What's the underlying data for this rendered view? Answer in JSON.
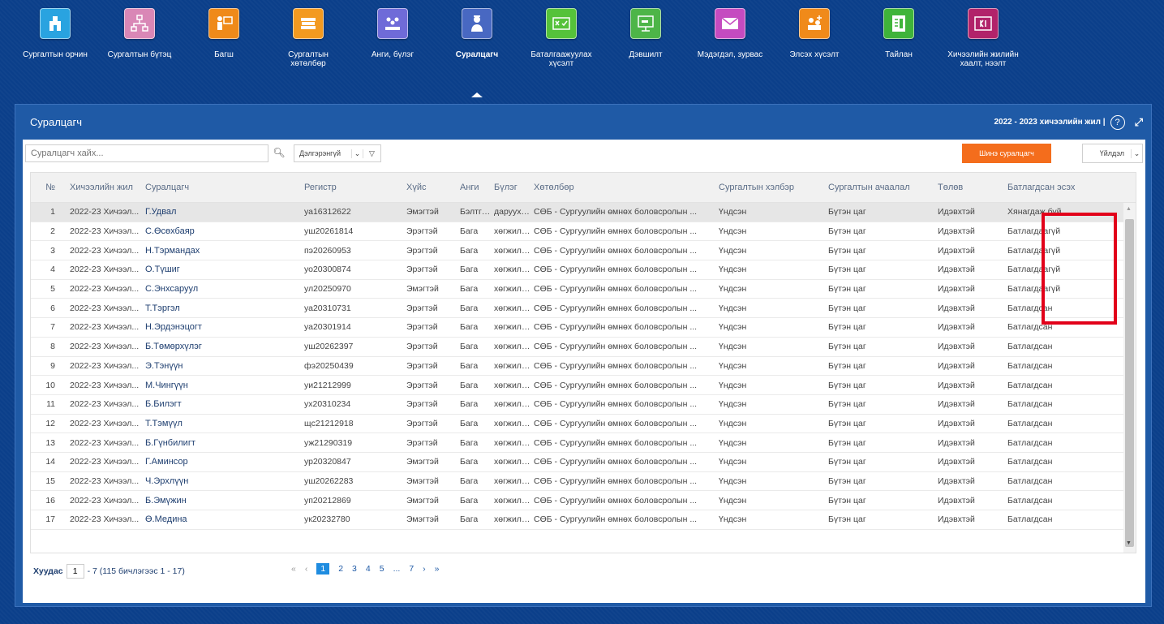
{
  "nav": [
    {
      "label": "Сургалтын орчин",
      "icon": "school-building-icon",
      "color": "#29a3e0",
      "active": false
    },
    {
      "label": "Сургалтын бүтэц",
      "icon": "structure-icon",
      "color": "#d987b6",
      "active": false
    },
    {
      "label": "Багш",
      "icon": "teacher-icon",
      "color": "#ef8a1a",
      "active": false
    },
    {
      "label": "Сургалтын хөтөлбөр",
      "icon": "books-icon",
      "color": "#f39a20",
      "active": false
    },
    {
      "label": "Анги, бүлэг",
      "icon": "classroom-icon",
      "color": "#6f6bd8",
      "active": false
    },
    {
      "label": "Суралцагч",
      "icon": "student-icon",
      "color": "#4868c2",
      "active": true
    },
    {
      "label": "Баталгаажуулах хүсэлт",
      "icon": "approval-request-icon",
      "color": "#55c23a",
      "active": false
    },
    {
      "label": "Дэвшилт",
      "icon": "promotion-icon",
      "color": "#4db548",
      "active": false
    },
    {
      "label": "Мэдэгдэл, зурвас",
      "icon": "message-icon",
      "color": "#c54bc0",
      "active": false
    },
    {
      "label": "Элсэх хүсэлт",
      "icon": "enrollment-request-icon",
      "color": "#f08a1a",
      "active": false
    },
    {
      "label": "Тайлан",
      "icon": "report-icon",
      "color": "#3fb43a",
      "active": false
    },
    {
      "label": "Хичээлийн жилийн хаалт, нээлт",
      "icon": "year-closing-icon",
      "color": "#b1236a",
      "active": false
    }
  ],
  "panel": {
    "title": "Суралцагч",
    "year": "2022 - 2023 хичээлийн жил |",
    "help": "?"
  },
  "toolbar": {
    "search_placeholder": "Суралцагч хайх...",
    "detail_label": "Дэлгэрэнгүй",
    "new_label": "Шинэ суралцагч",
    "action_label": "Үйлдэл"
  },
  "columns": {
    "num": "№",
    "year": "Хичээлийн жил",
    "student": "Суралцагч",
    "register": "Регистр",
    "sex": "Хүйс",
    "class": "Анги",
    "group": "Бүлэг",
    "program": "Хөтөлбөр",
    "form": "Сургалтын хэлбэр",
    "load": "Сургалтын ачаалал",
    "status": "Төлөв",
    "confirmed": "Батлагдсан эсэх"
  },
  "rows": [
    {
      "num": "1",
      "year": "2022-23 Хичээл...",
      "student": "Г.Удвал",
      "register": "уа16312622",
      "sex": "Эмэгтэй",
      "class": "Бэлтгэл",
      "group": "дарууха...",
      "program": "СӨБ - Сургуулийн өмнөх боловсролын ...",
      "form": "Үндсэн",
      "load": "Бүтэн цаг",
      "status": "Идэвхтэй",
      "confirmed": "Хянагдаж буй"
    },
    {
      "num": "2",
      "year": "2022-23 Хичээл...",
      "student": "С.Өсөхбаяр",
      "register": "уш20261814",
      "sex": "Эрэгтэй",
      "class": "Бага",
      "group": "хөгжилт...",
      "program": "СӨБ - Сургуулийн өмнөх боловсролын ...",
      "form": "Үндсэн",
      "load": "Бүтэн цаг",
      "status": "Идэвхтэй",
      "confirmed": "Батлагдаагүй"
    },
    {
      "num": "3",
      "year": "2022-23 Хичээл...",
      "student": "Н.Тэрмандах",
      "register": "пэ20260953",
      "sex": "Эрэгтэй",
      "class": "Бага",
      "group": "хөгжилт...",
      "program": "СӨБ - Сургуулийн өмнөх боловсролын ...",
      "form": "Үндсэн",
      "load": "Бүтэн цаг",
      "status": "Идэвхтэй",
      "confirmed": "Батлагдаагүй"
    },
    {
      "num": "4",
      "year": "2022-23 Хичээл...",
      "student": "О.Түшиг",
      "register": "уо20300874",
      "sex": "Эрэгтэй",
      "class": "Бага",
      "group": "хөгжилт...",
      "program": "СӨБ - Сургуулийн өмнөх боловсролын ...",
      "form": "Үндсэн",
      "load": "Бүтэн цаг",
      "status": "Идэвхтэй",
      "confirmed": "Батлагдаагүй"
    },
    {
      "num": "5",
      "year": "2022-23 Хичээл...",
      "student": "С.Энхсаруул",
      "register": "ул20250970",
      "sex": "Эмэгтэй",
      "class": "Бага",
      "group": "хөгжилт...",
      "program": "СӨБ - Сургуулийн өмнөх боловсролын ...",
      "form": "Үндсэн",
      "load": "Бүтэн цаг",
      "status": "Идэвхтэй",
      "confirmed": "Батлагдаагүй"
    },
    {
      "num": "6",
      "year": "2022-23 Хичээл...",
      "student": "Т.Тэргэл",
      "register": "уа20310731",
      "sex": "Эрэгтэй",
      "class": "Бага",
      "group": "хөгжилт...",
      "program": "СӨБ - Сургуулийн өмнөх боловсролын ...",
      "form": "Үндсэн",
      "load": "Бүтэн цаг",
      "status": "Идэвхтэй",
      "confirmed": "Батлагдсан"
    },
    {
      "num": "7",
      "year": "2022-23 Хичээл...",
      "student": "Н.Эрдэнэцогт",
      "register": "уа20301914",
      "sex": "Эрэгтэй",
      "class": "Бага",
      "group": "хөгжилт...",
      "program": "СӨБ - Сургуулийн өмнөх боловсролын ...",
      "form": "Үндсэн",
      "load": "Бүтэн цаг",
      "status": "Идэвхтэй",
      "confirmed": "Батлагдсан"
    },
    {
      "num": "8",
      "year": "2022-23 Хичээл...",
      "student": "Б.Төмөрхүлэг",
      "register": "уш20262397",
      "sex": "Эрэгтэй",
      "class": "Бага",
      "group": "хөгжилт...",
      "program": "СӨБ - Сургуулийн өмнөх боловсролын ...",
      "form": "Үндсэн",
      "load": "Бүтэн цаг",
      "status": "Идэвхтэй",
      "confirmed": "Батлагдсан"
    },
    {
      "num": "9",
      "year": "2022-23 Хичээл...",
      "student": "Э.Тэнүүн",
      "register": "фэ20250439",
      "sex": "Эрэгтэй",
      "class": "Бага",
      "group": "хөгжилт...",
      "program": "СӨБ - Сургуулийн өмнөх боловсролын ...",
      "form": "Үндсэн",
      "load": "Бүтэн цаг",
      "status": "Идэвхтэй",
      "confirmed": "Батлагдсан"
    },
    {
      "num": "10",
      "year": "2022-23 Хичээл...",
      "student": "М.Чингүүн",
      "register": "уи21212999",
      "sex": "Эрэгтэй",
      "class": "Бага",
      "group": "хөгжилт...",
      "program": "СӨБ - Сургуулийн өмнөх боловсролын ...",
      "form": "Үндсэн",
      "load": "Бүтэн цаг",
      "status": "Идэвхтэй",
      "confirmed": "Батлагдсан"
    },
    {
      "num": "11",
      "year": "2022-23 Хичээл...",
      "student": "Б.Билэгт",
      "register": "ух20310234",
      "sex": "Эрэгтэй",
      "class": "Бага",
      "group": "хөгжилт...",
      "program": "СӨБ - Сургуулийн өмнөх боловсролын ...",
      "form": "Үндсэн",
      "load": "Бүтэн цаг",
      "status": "Идэвхтэй",
      "confirmed": "Батлагдсан"
    },
    {
      "num": "12",
      "year": "2022-23 Хичээл...",
      "student": "Т.Тэмүүл",
      "register": "щс21212918",
      "sex": "Эрэгтэй",
      "class": "Бага",
      "group": "хөгжилт...",
      "program": "СӨБ - Сургуулийн өмнөх боловсролын ...",
      "form": "Үндсэн",
      "load": "Бүтэн цаг",
      "status": "Идэвхтэй",
      "confirmed": "Батлагдсан"
    },
    {
      "num": "13",
      "year": "2022-23 Хичээл...",
      "student": "Б.Гүнбилигт",
      "register": "уж21290319",
      "sex": "Эрэгтэй",
      "class": "Бага",
      "group": "хөгжилт...",
      "program": "СӨБ - Сургуулийн өмнөх боловсролын ...",
      "form": "Үндсэн",
      "load": "Бүтэн цаг",
      "status": "Идэвхтэй",
      "confirmed": "Батлагдсан"
    },
    {
      "num": "14",
      "year": "2022-23 Хичээл...",
      "student": "Г.Аминсор",
      "register": "ур20320847",
      "sex": "Эмэгтэй",
      "class": "Бага",
      "group": "хөгжилт...",
      "program": "СӨБ - Сургуулийн өмнөх боловсролын ...",
      "form": "Үндсэн",
      "load": "Бүтэн цаг",
      "status": "Идэвхтэй",
      "confirmed": "Батлагдсан"
    },
    {
      "num": "15",
      "year": "2022-23 Хичээл...",
      "student": "Ч.Эрхлүүн",
      "register": "уш20262283",
      "sex": "Эмэгтэй",
      "class": "Бага",
      "group": "хөгжилт...",
      "program": "СӨБ - Сургуулийн өмнөх боловсролын ...",
      "form": "Үндсэн",
      "load": "Бүтэн цаг",
      "status": "Идэвхтэй",
      "confirmed": "Батлагдсан"
    },
    {
      "num": "16",
      "year": "2022-23 Хичээл...",
      "student": "Б.Эмүжин",
      "register": "уп20212869",
      "sex": "Эмэгтэй",
      "class": "Бага",
      "group": "хөгжилт...",
      "program": "СӨБ - Сургуулийн өмнөх боловсролын ...",
      "form": "Үндсэн",
      "load": "Бүтэн цаг",
      "status": "Идэвхтэй",
      "confirmed": "Батлагдсан"
    },
    {
      "num": "17",
      "year": "2022-23 Хичээл...",
      "student": "Ө.Медина",
      "register": "ук20232780",
      "sex": "Эмэгтэй",
      "class": "Бага",
      "group": "хөгжилт...",
      "program": "СӨБ - Сургуулийн өмнөх боловсролын ...",
      "form": "Үндсэн",
      "load": "Бүтэн цаг",
      "status": "Идэвхтэй",
      "confirmed": "Батлагдсан"
    }
  ],
  "pager": {
    "label": "Хуудас",
    "page": "1",
    "info": "- 7 (115 бичлэгээс 1 - 17)",
    "first": "«",
    "prev": "‹",
    "pages": [
      "1",
      "2",
      "3",
      "4",
      "5",
      "...",
      "7"
    ],
    "next": "›",
    "last": "»"
  }
}
